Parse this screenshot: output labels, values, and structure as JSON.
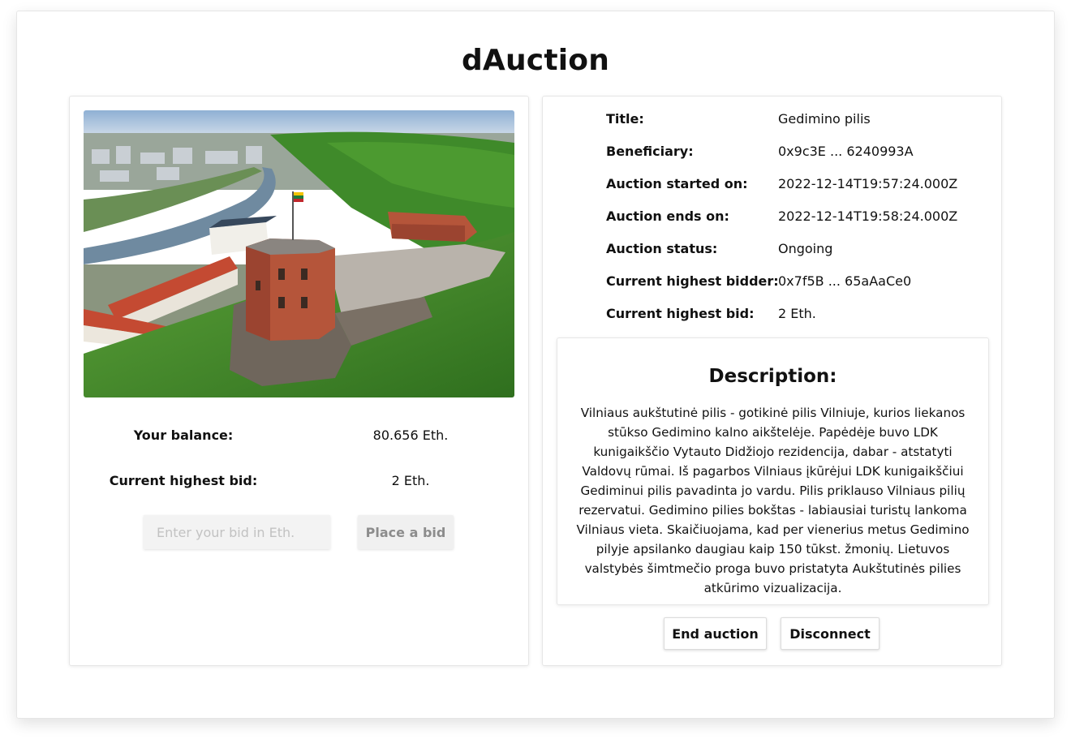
{
  "app": {
    "title": "dAuction"
  },
  "item": {
    "image_alt": "Gedimino pilis"
  },
  "bidding": {
    "balance_label": "Your balance:",
    "balance_value": "80.656 Eth.",
    "highest_bid_label": "Current highest bid:",
    "highest_bid_value": "2 Eth.",
    "input_placeholder": "Enter your bid in Eth.",
    "input_value": "",
    "place_bid_label": "Place a bid"
  },
  "details": {
    "rows": [
      {
        "label": "Title:",
        "value": "Gedimino pilis"
      },
      {
        "label": "Beneficiary:",
        "value": "0x9c3E ... 6240993A"
      },
      {
        "label": "Auction started on:",
        "value": "2022-12-14T19:57:24.000Z"
      },
      {
        "label": "Auction ends on:",
        "value": "2022-12-14T19:58:24.000Z"
      },
      {
        "label": "Auction status:",
        "value": "Ongoing"
      },
      {
        "label": "Current highest bidder:",
        "value": "0x7f5B ... 65aAaCe0"
      },
      {
        "label": "Current highest bid:",
        "value": "2 Eth."
      }
    ]
  },
  "description": {
    "title": "Description:",
    "text": "Vilniaus aukštutinė pilis - gotikinė pilis Vilniuje, kurios liekanos stūkso Gedimino kalno aikštelėje. Papėdėje buvo LDK kunigaikščio Vytauto Didžiojo rezidencija, dabar - atstatyti Valdovų rūmai. Iš pagarbos Vilniaus įkūrėjui LDK kunigaikščiui Gediminui pilis pavadinta jo vardu. Pilis priklauso Vilniaus pilių rezervatui. Gedimino pilies bokštas - labiausiai turistų lankoma Vilniaus vieta. Skaičiuojama, kad per vienerius metus Gedimino pilyje apsilanko daugiau kaip 150 tūkst. žmonių. Lietuvos valstybės šimtmečio proga buvo pristatyta Aukštutinės pilies atkūrimo vizualizacija."
  },
  "actions": {
    "end_auction_label": "End auction",
    "disconnect_label": "Disconnect"
  },
  "colors": {
    "sky": "#b9cfe6",
    "grass": "#4f9a2e",
    "brick": "#b5553a",
    "roof": "#c44a32",
    "river": "#6f8aa0",
    "plaza": "#b9b3ab"
  }
}
